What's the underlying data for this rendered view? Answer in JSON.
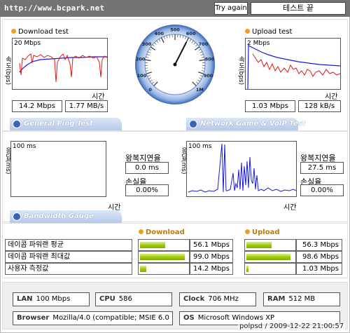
{
  "url": "http://www.bcpark.net",
  "buttons": {
    "try_again": "Try again",
    "test_end": "테스트 끝"
  },
  "download": {
    "title": "Download test",
    "y_axis_label": "속도(bps)",
    "scale_label": "20 Mbps",
    "time_label": "시간",
    "speed_mbps": "14.2 Mbps",
    "speed_mbs": "1.77 MB/s"
  },
  "upload": {
    "title": "Upload test",
    "y_axis_label": "속도(bps)",
    "scale_label": "2 Mbps",
    "time_label": "시간",
    "speed_mbps": "1.03 Mbps",
    "speed_kbs": "128 kB/s"
  },
  "gauge": {
    "ticks": [
      "0",
      "100",
      "200",
      "300",
      "400",
      "500",
      "600",
      "700",
      "800",
      "900",
      "1M"
    ],
    "needle_value": 600
  },
  "tabs": {
    "general_ping": "General Ping Test",
    "network_game": "Network Game & VoIP Test",
    "bandwidth_gauge": "Bandwidth Gauge"
  },
  "ping_general": {
    "y_axis_label": "응답(ms)",
    "scale_label": "100 ms",
    "time_label": "시간",
    "rtt_label": "왕복지연율",
    "rtt_value": "0.0 ms",
    "loss_label": "손실율",
    "loss_value": "0.00%"
  },
  "ping_game": {
    "y_axis_label": "응답(ms)",
    "scale_label": "100 ms",
    "time_label": "시간",
    "rtt_label": "왕복지연율",
    "rtt_value": "27.5 ms",
    "loss_label": "손실율",
    "loss_value": "0.00%"
  },
  "bandwidth": {
    "download_header": "Download",
    "upload_header": "Upload",
    "rows": [
      {
        "label": "데이콤 파워랜 평균",
        "download": "56.1 Mbps",
        "download_fraction": 0.36,
        "upload": "56.3 Mbps",
        "upload_fraction": 0.36
      },
      {
        "label": "데이콤 파워랜 최대값",
        "download": "99.0 Mbps",
        "download_fraction": 0.64,
        "upload": "98.6 Mbps",
        "upload_fraction": 0.63
      },
      {
        "label": "사용자 측정값",
        "download": "14.2 Mbps",
        "download_fraction": 0.09,
        "upload": "1.03 Mbps",
        "upload_fraction": 0.01
      }
    ]
  },
  "sysinfo": {
    "lan_label": "LAN",
    "lan_value": "100 Mbps",
    "cpu_label": "CPU",
    "cpu_value": "586",
    "clock_label": "Clock",
    "clock_value": "706 MHz",
    "ram_label": "RAM",
    "ram_value": "512 MB",
    "browser_label": "Browser",
    "browser_value": "Mozilla/4.0 (compatible; MSIE 6.0",
    "os_label": "OS",
    "os_value": "Microsoft Windows XP"
  },
  "footer": "polpsd / 2009-12-22 21:00:57",
  "colors": {
    "header": "#737373",
    "download_line": "#1a1ad8",
    "upload_line": "#e01818",
    "tab": "#b6c9ec",
    "bar": "#9cc800",
    "orb": "#f0a020"
  }
}
